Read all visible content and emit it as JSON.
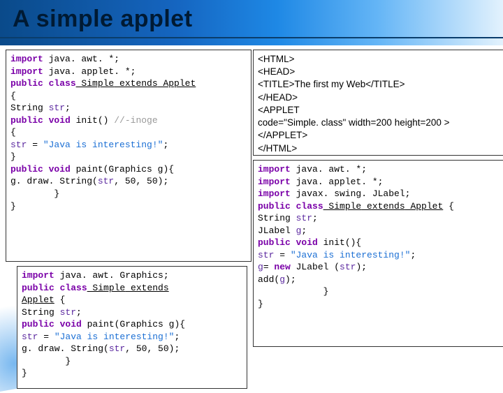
{
  "header": {
    "title": "A simple applet"
  },
  "box1": {
    "l1a": "import",
    "l1b": " java. awt. *;",
    "l2a": "import",
    "l2b": " java. applet. *;",
    "l3a": "public class",
    "l3b": " Simple",
    "l3c": " extends",
    "l3d": " Applet",
    "l4": "{",
    "l5a": "String ",
    "l5b": "str",
    "l5c": ";",
    "l6a": "public void",
    "l6b": " init() ",
    "l6c": "//-inoge",
    "l7": "{",
    "l8a": "str",
    "l8b": " = ",
    "l8c": "\"Java is interesting!\"",
    "l8d": ";",
    "l9": "}",
    "l10a": "public void",
    "l10b": " paint(Graphics g){",
    "l11a": "g. draw. String(",
    "l11b": "str",
    "l11c": ", 50, 50);",
    "l12": "        }",
    "l13": "}"
  },
  "box2": {
    "l1": "<HTML>",
    "l2": "<HEAD>",
    "l3": "<TITLE>The first my Web</TITLE>",
    "l4": "</HEAD>",
    "l5": "<APPLET",
    "l6": "code=\"Simple. class\" width=200 height=200 >",
    "l7": "</APPLET>",
    "l8": "</HTML>"
  },
  "box3": {
    "l1a": "import",
    "l1b": " java. awt. *;",
    "l2a": "import",
    "l2b": " java. applet. *;",
    "l3a": "import",
    "l3b": " javax. swing. JLabel;",
    "l4a": "public class",
    "l4b": " Simple",
    "l4c": " extends",
    "l4d": " Applet",
    "l4e": " {",
    "l5a": "String ",
    "l5b": "str",
    "l5c": ";",
    "l6a": "JLabel ",
    "l6b": "g",
    "l6c": ";",
    "l7a": "public void",
    "l7b": " init(){",
    "l8a": "str",
    "l8b": " = ",
    "l8c": "\"Java is interesting!\"",
    "l8d": ";",
    "l9a": "g",
    "l9b": "= ",
    "l9c": "new",
    "l9d": " JLabel (",
    "l9e": "str",
    "l9f": ");",
    "l10a": "add(",
    "l10b": "g",
    "l10c": ");",
    "l11": "            }",
    "l12": "}"
  },
  "box4": {
    "l1a": "import",
    "l1b": " java. awt. Graphics;",
    "l2a": "public class",
    "l2b": " Simple",
    "l2c": " extends",
    "l3a": "Applet",
    "l3b": " {",
    "l4a": "String ",
    "l4b": "str",
    "l4c": ";",
    "l5a": "public void",
    "l5b": " paint(Graphics g){",
    "l6a": "str",
    "l6b": " = ",
    "l6c": "\"Java is interesting!\"",
    "l6d": ";",
    "l7a": "g. draw. String(",
    "l7b": "str",
    "l7c": ", 50, 50);",
    "l8": "        }",
    "l9": "}"
  }
}
